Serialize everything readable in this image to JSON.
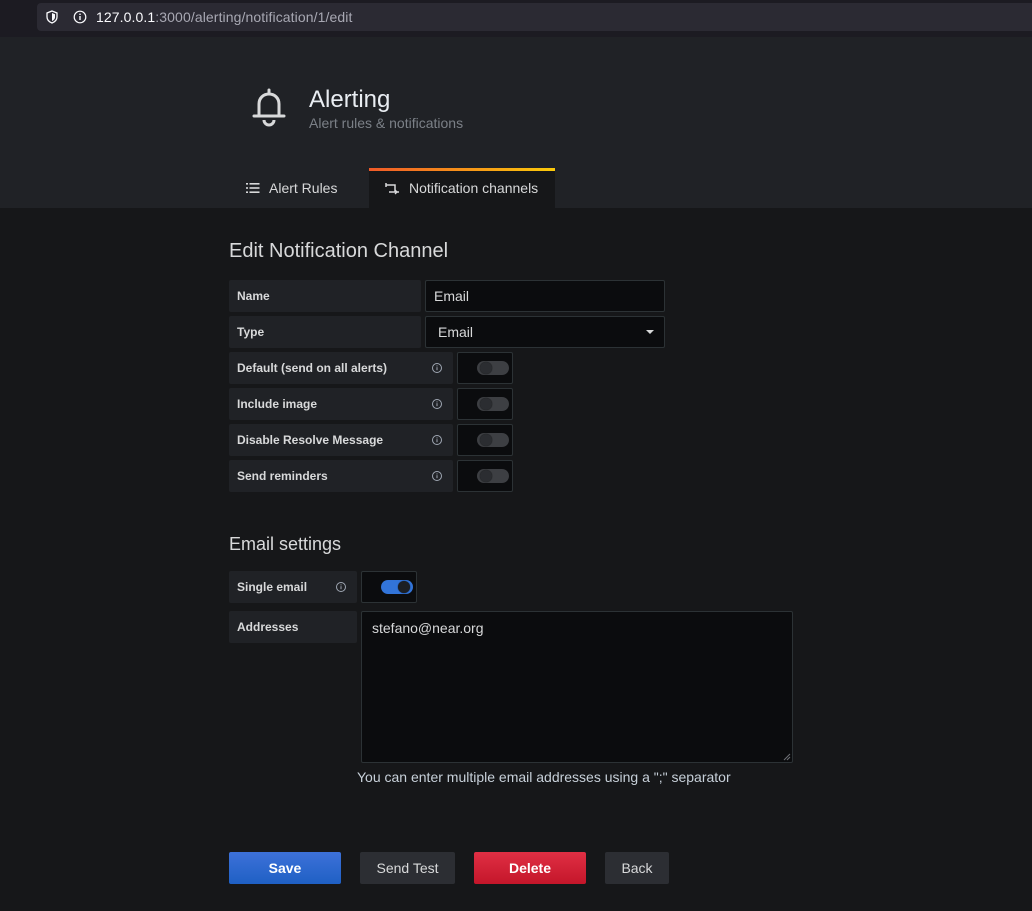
{
  "browser": {
    "url_host": "127.0.0.1",
    "url_path": ":3000/alerting/notification/1/edit"
  },
  "header": {
    "title": "Alerting",
    "subtitle": "Alert rules & notifications",
    "icon": "bell-icon"
  },
  "tabs": [
    {
      "label": "Alert Rules",
      "icon": "list-icon",
      "active": false
    },
    {
      "label": "Notification channels",
      "icon": "channel-icon",
      "active": true
    }
  ],
  "form": {
    "title": "Edit Notification Channel",
    "name_label": "Name",
    "name_value": "Email",
    "type_label": "Type",
    "type_value": "Email",
    "toggles": [
      {
        "label": "Default (send on all alerts)",
        "on": false
      },
      {
        "label": "Include image",
        "on": false
      },
      {
        "label": "Disable Resolve Message",
        "on": false
      },
      {
        "label": "Send reminders",
        "on": false
      }
    ]
  },
  "email_settings": {
    "title": "Email settings",
    "single_email_label": "Single email",
    "single_email_on": true,
    "addresses_label": "Addresses",
    "addresses_value": "stefano@near.org",
    "hint": "You can enter multiple email addresses using a \";\" separator"
  },
  "buttons": {
    "save": "Save",
    "send_test": "Send Test",
    "delete": "Delete",
    "back": "Back"
  },
  "colors": {
    "primary": "#3274d9",
    "danger": "#e02f44",
    "tab_gradient_start": "#f05a28",
    "tab_gradient_end": "#fbca0a"
  }
}
